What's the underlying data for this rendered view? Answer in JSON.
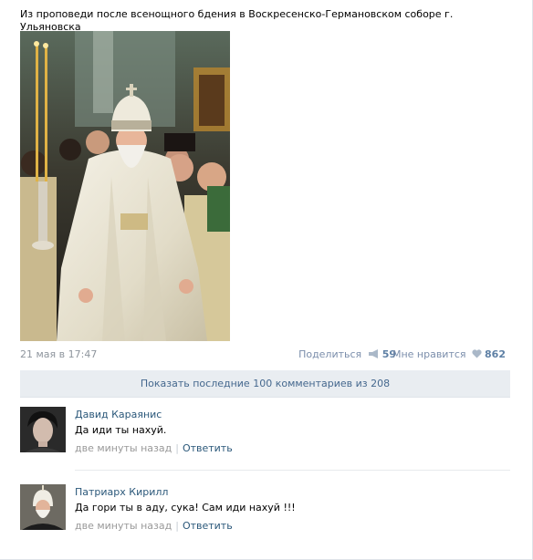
{
  "post": {
    "text": "Из проповеди после всенощного бдения в Воскресенско-Германовском соборе г. Ульяновска",
    "date": "21 мая в 17:47"
  },
  "actions": {
    "share_label": "Поделиться",
    "share_count": "59",
    "like_label": "Мне нравится",
    "like_count": "862",
    "share_icon": "megaphone-icon",
    "like_icon": "heart-icon"
  },
  "show_more": {
    "label": "Показать последние 100 комментариев из 208"
  },
  "comments": [
    {
      "author": "Давид Караянис",
      "text": "Да иди ты нахуй.",
      "time": "две минуты назад",
      "reply": "Ответить"
    },
    {
      "author": "Патриарх Кирилл",
      "text": "Да гори ты в аду, сука! Сам иди нахуй !!!",
      "time": "две минуты назад",
      "reply": "Ответить"
    }
  ],
  "colors": {
    "link": "#2b587a",
    "accent": "#45688e",
    "muted": "#999999",
    "bar_bg": "#e9edf1"
  }
}
